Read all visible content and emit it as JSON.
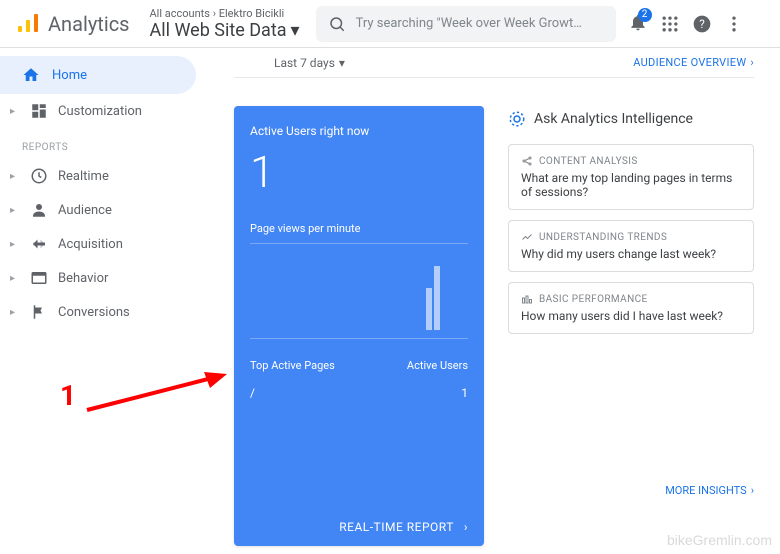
{
  "header": {
    "brand": "Analytics",
    "breadcrumb_all": "All accounts",
    "breadcrumb_account": "Elektro Bicikli",
    "view_name": "All Web Site Data",
    "search_placeholder": "Try searching \"Week over Week Growt…",
    "notif_count": "2"
  },
  "sidebar": {
    "home": "Home",
    "customization": "Customization",
    "reports_label": "REPORTS",
    "items": [
      {
        "label": "Realtime"
      },
      {
        "label": "Audience"
      },
      {
        "label": "Acquisition"
      },
      {
        "label": "Behavior"
      },
      {
        "label": "Conversions"
      }
    ]
  },
  "toprow": {
    "date_range": "Last 7 days",
    "audience_link": "AUDIENCE OVERVIEW"
  },
  "realtime_card": {
    "title": "Active Users right now",
    "count": "1",
    "pvpm": "Page views per minute",
    "tap_header": "Top Active Pages",
    "au_header": "Active Users",
    "page": "/",
    "page_count": "1",
    "footer": "REAL-TIME REPORT"
  },
  "intel": {
    "title": "Ask Analytics Intelligence",
    "suggestions": [
      {
        "cat": "CONTENT ANALYSIS",
        "q": "What are my top landing pages in terms of sessions?"
      },
      {
        "cat": "UNDERSTANDING TRENDS",
        "q": "Why did my users change last week?"
      },
      {
        "cat": "BASIC PERFORMANCE",
        "q": "How many users did I have last week?"
      }
    ],
    "more": "MORE INSIGHTS"
  },
  "annotation": {
    "number": "1"
  },
  "watermark": "bikeGremlin.com",
  "chart_data": {
    "type": "bar",
    "title": "Page views per minute",
    "categories_note": "last-minute buckets (unlabeled)",
    "values_note": "two visible bars near right edge, approx heights",
    "values": [
      0,
      0,
      0,
      0,
      0,
      0,
      0,
      0,
      0,
      0,
      0,
      0,
      0,
      0,
      0,
      0,
      0,
      0,
      0,
      0,
      0,
      0,
      0,
      0,
      0,
      0,
      0,
      0,
      1,
      2
    ]
  }
}
